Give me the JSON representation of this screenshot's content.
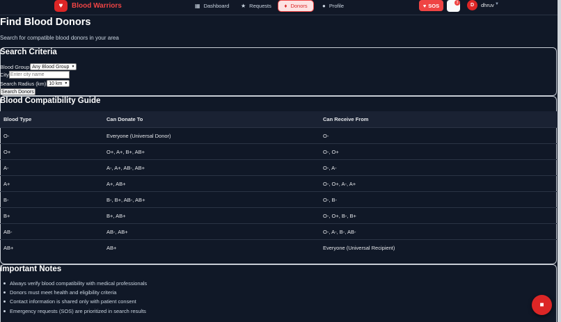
{
  "navbar": {
    "brand_icon": "heart-icon",
    "brand_name": "Blood Warriors",
    "items": [
      {
        "label": "Dashboard",
        "icon": "grid-icon"
      },
      {
        "label": "Requests",
        "icon": "star-icon"
      },
      {
        "label": "Donors",
        "icon": "drop-icon",
        "active": true
      },
      {
        "label": "Profile",
        "icon": "user-icon"
      }
    ],
    "sos_label": "SOS",
    "notification_count": "3",
    "avatar_initial": "D",
    "username": "dhruv"
  },
  "page": {
    "title": "Find Blood Donors",
    "subtitle": "Search for compatible blood donors in your area"
  },
  "search": {
    "title": "Search Criteria",
    "blood_group_label": "Blood Group",
    "blood_group_value": "Any Blood Group",
    "city_label": "City",
    "city_placeholder": "Enter city name",
    "radius_label": "Search Radius (km)",
    "radius_value": "10 km",
    "button_label": "Search Donors"
  },
  "compat": {
    "title": "Blood Compatibility Guide",
    "headers": [
      "Blood Type",
      "Can Donate To",
      "Can Receive From"
    ],
    "rows": [
      [
        "O-",
        "Everyone (Universal Donor)",
        "O-"
      ],
      [
        "O+",
        "O+, A+, B+, AB+",
        "O-, O+"
      ],
      [
        "A-",
        "A-, A+, AB-, AB+",
        "O-, A-"
      ],
      [
        "A+",
        "A+, AB+",
        "O-, O+, A-, A+"
      ],
      [
        "B-",
        "B-, B+, AB-, AB+",
        "O-, B-"
      ],
      [
        "B+",
        "B+, AB+",
        "O-, O+, B-, B+"
      ],
      [
        "AB-",
        "AB-, AB+",
        "O-, A-, B-, AB-"
      ],
      [
        "AB+",
        "AB+",
        "Everyone (Universal Recipient)"
      ]
    ]
  },
  "notes": {
    "title": "Important Notes",
    "items": [
      "Always verify blood compatibility with medical professionals",
      "Donors must meet health and eligibility criteria",
      "Contact information is shared only with patient consent",
      "Emergency requests (SOS) are prioritized in search results"
    ]
  },
  "colors": {
    "background": "#101827",
    "accent": "#dc2626",
    "sos": "#ef4444"
  }
}
